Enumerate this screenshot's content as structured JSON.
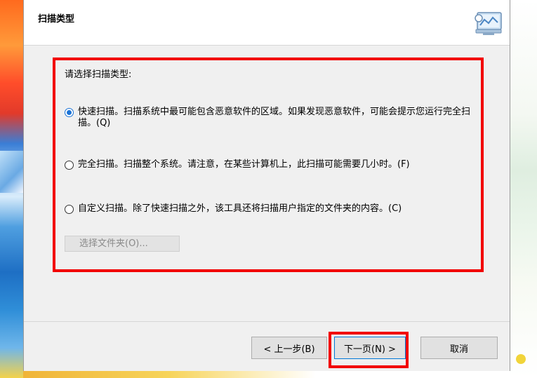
{
  "dialog": {
    "title": "扫描类型"
  },
  "content": {
    "prompt": "请选择扫描类型:",
    "options": [
      {
        "label": "快速扫描。扫描系统中最可能包含恶意软件的区域。如果发现恶意软件，可能会提示您运行完全扫描。(Q)",
        "checked": true
      },
      {
        "label": "完全扫描。扫描整个系统。请注意，在某些计算机上，此扫描可能需要几小时。(F)",
        "checked": false
      },
      {
        "label": "自定义扫描。除了快速扫描之外，该工具还将扫描用户指定的文件夹的内容。(C)",
        "checked": false
      }
    ],
    "browse_button": "选择文件夹(O)..."
  },
  "buttons": {
    "back": "< 上一步(B)",
    "next": "下一页(N) >",
    "cancel": "取消"
  },
  "icons": {
    "header_icon": "computer-scan-icon"
  },
  "colors": {
    "highlight": "#f20000",
    "accent": "#1b73d6"
  }
}
